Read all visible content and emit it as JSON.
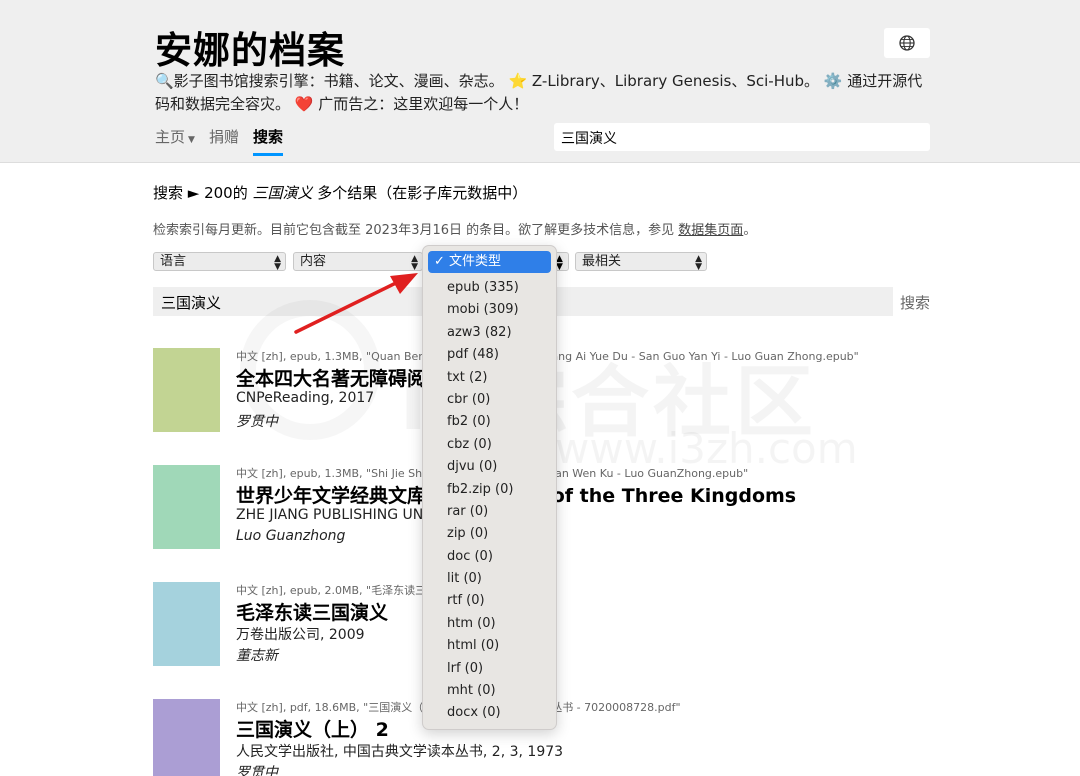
{
  "header": {
    "title": "安娜的档案",
    "tagline": "🔍影子图书馆搜索引擎：书籍、论文、漫画、杂志。 ⭐️ Z-Library、Library Genesis、Sci-Hub。 ⚙️ 通过开源代码和数据完全容灾。 ❤️ 广而告之：这里欢迎每一个人！",
    "globe_icon": "globe-icon",
    "nav": {
      "home": "主页",
      "donate": "捐赠",
      "search": "搜索"
    },
    "search_value": "三国演义"
  },
  "results_header": {
    "prefix": "搜索 ► 200的 ",
    "query": "三国演义",
    "suffix": " 多个结果（在影子库元数据中）"
  },
  "info": {
    "text": "检索索引每月更新。目前它包含截至 2023年3月16日 的条目。欲了解更多技术信息，参见 ",
    "link": "数据集页面",
    "end": "。"
  },
  "filters": {
    "language": "语言",
    "content": "内容",
    "sort": "最相关"
  },
  "dropdown": {
    "selected": "✓ 文件类型",
    "options": [
      "epub (335)",
      "mobi (309)",
      "azw3 (82)",
      "pdf (48)",
      "txt (2)",
      "cbr (0)",
      "fb2 (0)",
      "cbz (0)",
      "djvu (0)",
      "fb2.zip (0)",
      "rar (0)",
      "zip (0)",
      "doc (0)",
      "lit (0)",
      "rtf (0)",
      "htm (0)",
      "html (0)",
      "lrf (0)",
      "mht (0)",
      "docx (0)"
    ]
  },
  "query_input": "三国演义",
  "search_button": "搜索",
  "results": [
    {
      "meta": "中文 [zh], epub, 1.3MB, \"Quan Ben Si Da Ming Zhu Wu Zhang Ai Yue Du - San Guo Yan Yi - Luo Guan Zhong.epub\"",
      "title": "全本四大名著无障碍阅读 - 三国演义",
      "publisher": "CNPeReading, 2017",
      "author": "罗贯中",
      "cover_color": "#c2d493"
    },
    {
      "meta": "中文 [zh], epub, 1.3MB, \"Shi Jie Shao Nian Wen Xue Jing Dian Wen Ku - Luo GuanZhong.epub\"",
      "title": "世界少年文学经典文库 - Romance of the Three Kingdoms",
      "publisher": "ZHE JIANG PUBLISHING UNITED GROUP",
      "author": "Luo Guanzhong",
      "cover_color": "#a0d8b8"
    },
    {
      "meta": "中文 [zh], epub, 2.0MB, \"毛泽东读三国演义.epub\"",
      "title": "毛泽东读三国演义",
      "publisher": "万卷出版公司, 2009",
      "author": "董志新",
      "cover_color": "#a5d2dd"
    },
    {
      "meta": "中文 [zh], pdf, 18.6MB, \"三国演义（上）2 - 中国古典文学读本丛书 - 7020008728.pdf\"",
      "title": "三国演义（上） 2",
      "publisher": "人民文学出版社, 中国古典文学读本丛书, 2, 3, 1973",
      "author": "罗贯中",
      "cover_color": "#ab9ed4"
    }
  ],
  "watermark": {
    "text": "i3综合社区",
    "url": "www.i3zh.com"
  }
}
